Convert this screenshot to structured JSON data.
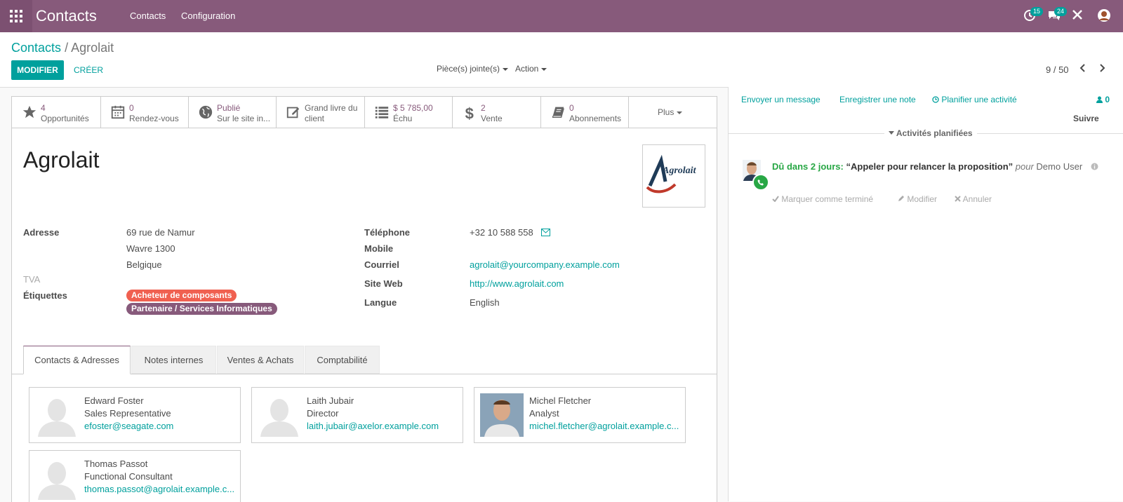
{
  "topbar": {
    "app_name": "Contacts",
    "menu": [
      "Contacts",
      "Configuration"
    ],
    "activity_count": "15",
    "message_count": "24",
    "colors": {
      "bar": "#875a7b",
      "accent": "#00a09d"
    }
  },
  "breadcrumb": {
    "parent": "Contacts",
    "separator": "/",
    "current": "Agrolait"
  },
  "buttons": {
    "edit": "MODIFIER",
    "create": "CRÉER"
  },
  "dropdowns": {
    "attachments": "Pièce(s) jointe(s)",
    "action": "Action"
  },
  "pager": {
    "text": "9 / 50"
  },
  "smart_buttons": [
    {
      "icon": "star-icon",
      "value": "4",
      "label": "Opportunités"
    },
    {
      "icon": "calendar-icon",
      "value": "0",
      "label": "Rendez-vous"
    },
    {
      "icon": "globe-icon",
      "value": "Publié",
      "label": "Sur le site in..."
    },
    {
      "icon": "edit-icon",
      "line1": "Grand livre du",
      "line2": "client"
    },
    {
      "icon": "list-icon",
      "value": "$ 5 785,00",
      "label": "Échu"
    },
    {
      "icon": "dollar-icon",
      "value": "2",
      "label": "Vente"
    },
    {
      "icon": "book-icon",
      "value": "0",
      "label": "Abonnements"
    },
    {
      "label": "Plus"
    }
  ],
  "partner": {
    "name": "Agrolait",
    "logo_text": "Agrolait",
    "labels": {
      "address": "Adresse",
      "vat": "TVA",
      "tags": "Étiquettes",
      "phone": "Téléphone",
      "mobile": "Mobile",
      "email": "Courriel",
      "website": "Site Web",
      "language": "Langue"
    },
    "street": "69 rue de Namur",
    "city_zip": "Wavre  1300",
    "country": "Belgique",
    "tags": [
      {
        "name": "Acheteur de composants",
        "color": "#f06050"
      },
      {
        "name": "Partenaire / Services Informatiques",
        "color": "#875a7b"
      }
    ],
    "phone": "+32 10 588 558",
    "email": "agrolait@yourcompany.example.com",
    "website": "http://www.agrolait.com",
    "language": "English"
  },
  "tabs": [
    "Contacts & Adresses",
    "Notes internes",
    "Ventes & Achats",
    "Comptabilité"
  ],
  "contacts": [
    {
      "name": "Edward Foster",
      "function": "Sales Representative",
      "email": "efoster@seagate.com"
    },
    {
      "name": "Laith Jubair",
      "function": "Director",
      "email": "laith.jubair@axelor.example.com"
    },
    {
      "name": "Michel Fletcher",
      "function": "Analyst",
      "email": "michel.fletcher@agrolait.example.c..."
    },
    {
      "name": "Thomas Passot",
      "function": "Functional Consultant",
      "email": "thomas.passot@agrolait.example.c..."
    }
  ],
  "chatter": {
    "send_message": "Envoyer un message",
    "log_note": "Enregistrer une note",
    "schedule": "Planifier une activité",
    "followers": "0",
    "follow": "Suivre",
    "section_title": "Activités planifiées",
    "activity": {
      "due": "Dû dans 2 jours:",
      "summary": "“Appeler pour relancer la proposition”",
      "for": "pour",
      "user": "Demo User"
    },
    "tools": {
      "done": "Marquer comme terminé",
      "edit": "Modifier",
      "cancel": "Annuler"
    }
  }
}
